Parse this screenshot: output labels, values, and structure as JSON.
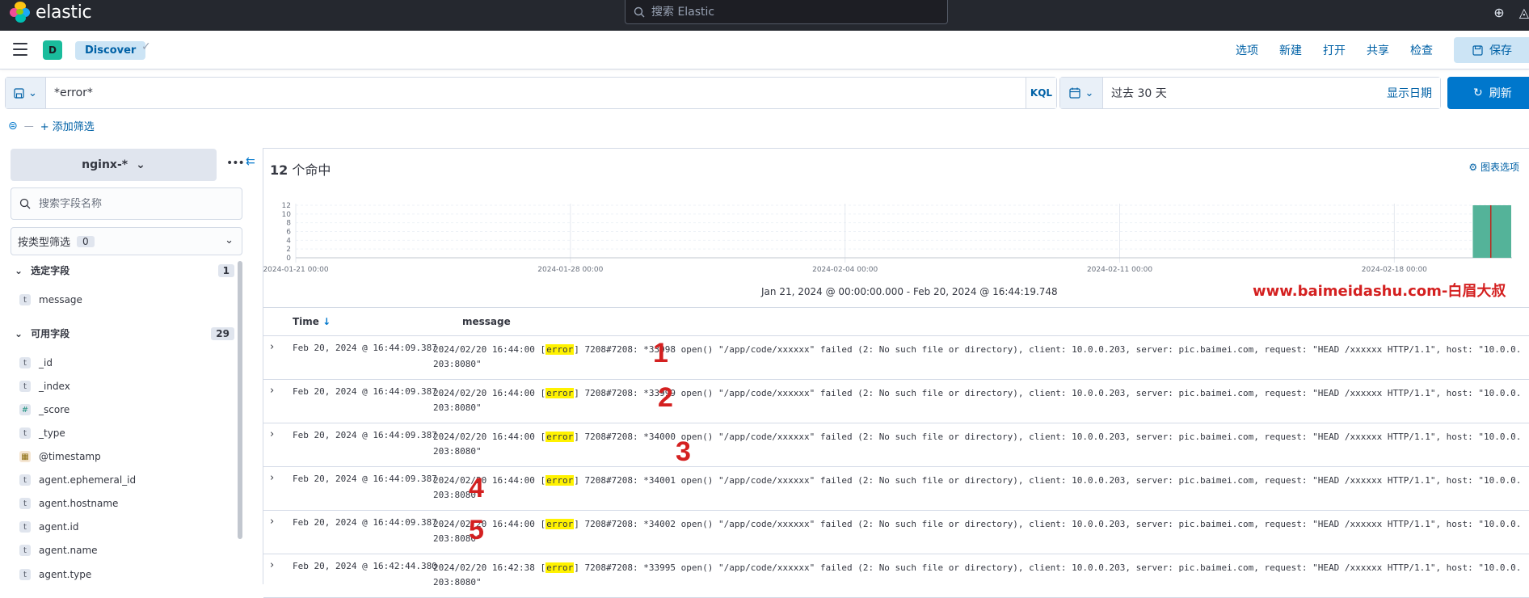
{
  "header": {
    "brand": "elastic",
    "search_placeholder": "搜索 Elastic"
  },
  "appbar": {
    "space_initial": "D",
    "breadcrumb": "Discover",
    "links": [
      "选项",
      "新建",
      "打开",
      "共享",
      "检查"
    ],
    "save_label": "保存"
  },
  "query": {
    "value": "*error*",
    "language": "KQL"
  },
  "datepicker": {
    "range": "过去 30 天",
    "show_dates": "显示日期",
    "refresh_label": "刷新"
  },
  "filters": {
    "add_filter": "+ 添加筛选"
  },
  "sidebar": {
    "index_pattern": "nginx-*",
    "field_search_placeholder": "搜索字段名称",
    "type_filter_label": "按类型筛选",
    "type_filter_count": "0",
    "selected_group": {
      "label": "选定字段",
      "count": "1"
    },
    "selected_fields": [
      {
        "type": "t",
        "name": "message"
      }
    ],
    "available_group": {
      "label": "可用字段",
      "count": "29"
    },
    "available_fields": [
      {
        "type": "t",
        "name": "_id"
      },
      {
        "type": "t",
        "name": "_index"
      },
      {
        "type": "#",
        "name": "_score"
      },
      {
        "type": "t",
        "name": "_type"
      },
      {
        "type": "cal",
        "name": "@timestamp"
      },
      {
        "type": "t",
        "name": "agent.ephemeral_id"
      },
      {
        "type": "t",
        "name": "agent.hostname"
      },
      {
        "type": "t",
        "name": "agent.id"
      },
      {
        "type": "t",
        "name": "agent.name"
      },
      {
        "type": "t",
        "name": "agent.type"
      }
    ]
  },
  "main": {
    "hit_count": "12",
    "hit_suffix": " 个命中",
    "chart_options": "图表选项",
    "range_label": "Jan 21, 2024 @ 00:00:00.000 - Feb 20, 2024 @ 16:44:19.748",
    "watermark": "www.baimeidashu.com-白眉大叔",
    "columns": {
      "time": "Time",
      "message": "message"
    }
  },
  "chart_data": {
    "type": "bar",
    "y_ticks": [
      "0",
      "2",
      "4",
      "6",
      "8",
      "10",
      "12"
    ],
    "ylim": [
      0,
      12
    ],
    "x_ticks": [
      "2024-01-21 00:00",
      "2024-01-28 00:00",
      "2024-02-04 00:00",
      "2024-02-11 00:00",
      "2024-02-18 00:00"
    ],
    "bars": [
      {
        "date": "2024-02-20",
        "count": 12
      }
    ],
    "color": "#54b399"
  },
  "rows": [
    {
      "time": "Feb 20, 2024 @ 16:44:09.387",
      "pre": "2024/02/20 16:44:00 [",
      "hl": "error",
      "post": "] 7208#7208: *33998 open() \"/app/code/xxxxxx\" failed (2: No such file or directory), client: 10.0.0.203, server: pic.baimei.com, request: \"HEAD /xxxxxx HTTP/1.1\", host: \"10.0.0.203:8080\""
    },
    {
      "time": "Feb 20, 2024 @ 16:44:09.387",
      "pre": "2024/02/20 16:44:00 [",
      "hl": "error",
      "post": "] 7208#7208: *33999 open() \"/app/code/xxxxxx\" failed (2: No such file or directory), client: 10.0.0.203, server: pic.baimei.com, request: \"HEAD /xxxxxx HTTP/1.1\", host: \"10.0.0.203:8080\""
    },
    {
      "time": "Feb 20, 2024 @ 16:44:09.387",
      "pre": "2024/02/20 16:44:00 [",
      "hl": "error",
      "post": "] 7208#7208: *34000 open() \"/app/code/xxxxxx\" failed (2: No such file or directory), client: 10.0.0.203, server: pic.baimei.com, request: \"HEAD /xxxxxx HTTP/1.1\", host: \"10.0.0.203:8080\""
    },
    {
      "time": "Feb 20, 2024 @ 16:44:09.387",
      "pre": "2024/02/20 16:44:00 [",
      "hl": "error",
      "post": "] 7208#7208: *34001 open() \"/app/code/xxxxxx\" failed (2: No such file or directory), client: 10.0.0.203, server: pic.baimei.com, request: \"HEAD /xxxxxx HTTP/1.1\", host: \"10.0.0.203:8080\""
    },
    {
      "time": "Feb 20, 2024 @ 16:44:09.387",
      "pre": "2024/02/20 16:44:00 [",
      "hl": "error",
      "post": "] 7208#7208: *34002 open() \"/app/code/xxxxxx\" failed (2: No such file or directory), client: 10.0.0.203, server: pic.baimei.com, request: \"HEAD /xxxxxx HTTP/1.1\", host: \"10.0.0.203:8080\""
    },
    {
      "time": "Feb 20, 2024 @ 16:42:44.380",
      "pre": "2024/02/20 16:42:38 [",
      "hl": "error",
      "post": "] 7208#7208: *33995 open() \"/app/code/xxxxxx\" failed (2: No such file or directory), client: 10.0.0.203, server: pic.baimei.com, request: \"HEAD /xxxxxx HTTP/1.1\", host: \"10.0.0.203:8080\""
    }
  ],
  "annotations": [
    "1",
    "2",
    "3",
    "4",
    "5"
  ]
}
